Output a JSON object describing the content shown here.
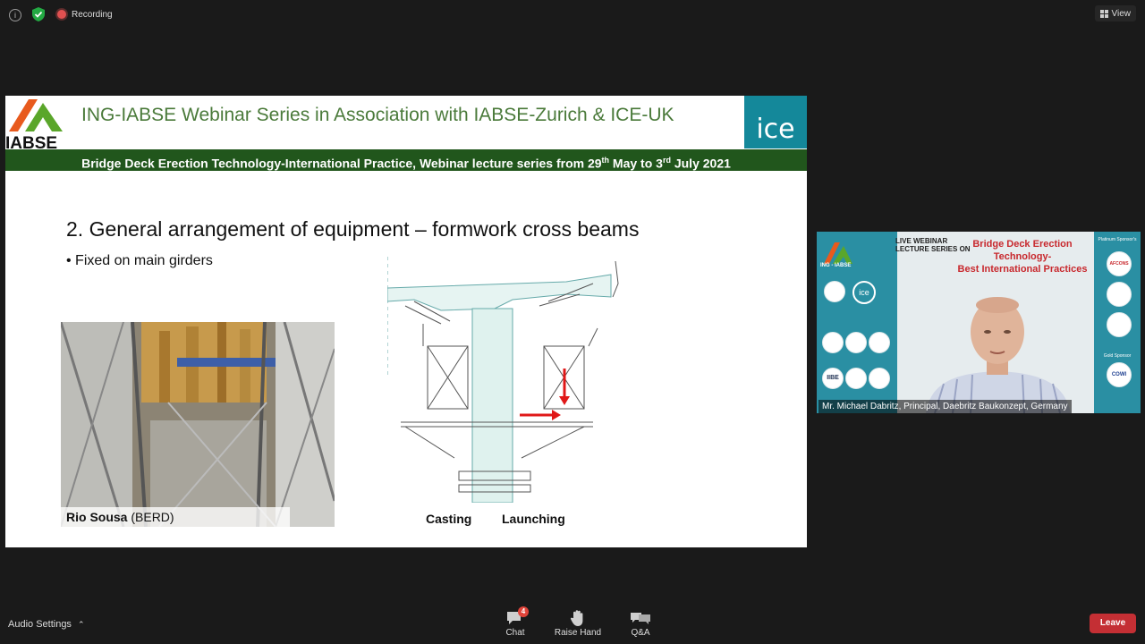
{
  "topbar": {
    "recording_label": "Recording",
    "view_label": "View"
  },
  "slide": {
    "logo_text": "IABSE",
    "title": "ING-IABSE Webinar Series in Association with IABSE-Zurich & ICE-UK",
    "ice_logo": "ice",
    "banner_pre": "Bridge Deck Erection Technology-International Practice, Webinar lecture series  from 29",
    "banner_sup1": "th",
    "banner_mid": " May to 3",
    "banner_sup2": "rd",
    "banner_post": " July 2021",
    "heading": "2.   General arrangement of equipment – formwork cross beams",
    "bullet": "•  Fixed on main girders",
    "photo_caption_bold": "Rio Sousa",
    "photo_caption_rest": " (BERD)",
    "label_casting": "Casting",
    "label_launching": "Launching"
  },
  "speaker": {
    "live_line1": "LIVE WEBINAR",
    "live_line2": "LECTURE SERIES ON",
    "title_line1": "Bridge Deck Erection Technology-",
    "title_line2": "Best International Practices",
    "logo_text": "ING - IABSE",
    "platinum_label": "Platinum Sponsor's",
    "gold_label": "Gold Sponsor",
    "sponsor_afcons": "AFCONS",
    "sponsor_cowi": "COWI",
    "sponsor_ice": "ice",
    "sponsor_ibe": "IIBE",
    "name": "Mr. Michael Dabritz, Principal, Daebritz Baukonzept, Germany"
  },
  "bottombar": {
    "audio_settings": "Audio Settings",
    "chat_label": "Chat",
    "chat_badge": "4",
    "raise_hand_label": "Raise Hand",
    "qa_label": "Q&A",
    "leave_label": "Leave"
  },
  "colors": {
    "background": "#1a1a1a",
    "slide_title_green": "#4a7a3a",
    "banner_green": "#21561c",
    "ice_teal": "#14889a",
    "leave_red": "#c42f34",
    "arrow_red": "#e01818"
  },
  "icons": [
    "info-icon",
    "shield-check-icon",
    "record-icon",
    "view-grid-icon",
    "chevron-up-icon",
    "chat-icon",
    "hand-icon",
    "qa-icon"
  ]
}
